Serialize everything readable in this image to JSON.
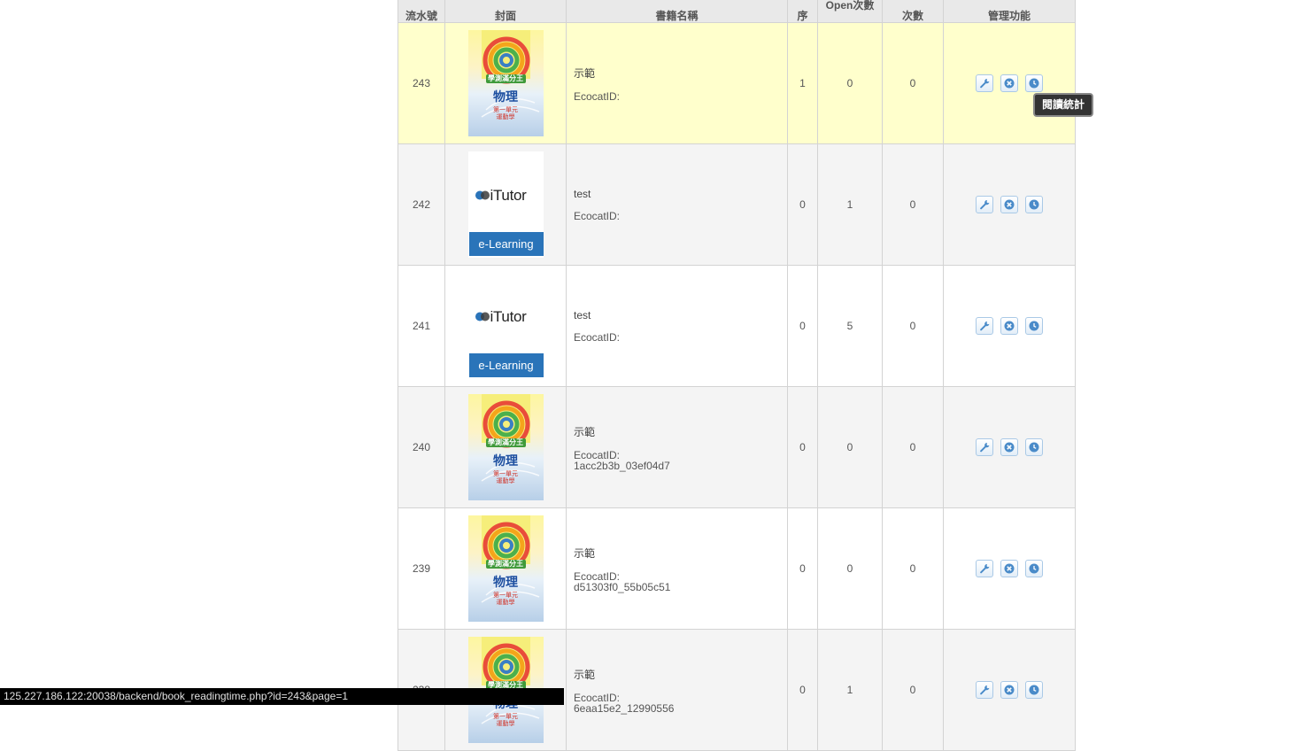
{
  "table": {
    "headers": {
      "serial": "流水號",
      "cover": "封面",
      "book_name": "書籍名稱",
      "order": "序",
      "open_count": "Open次數",
      "download_count": "次數",
      "manage": "管理功能"
    },
    "rows": [
      {
        "id": "243",
        "title": "示範",
        "ecocat_label": "EcocatID:",
        "ecocat_id": "",
        "order": "1",
        "open": "0",
        "download": "0",
        "cover": "physics",
        "highlight": true
      },
      {
        "id": "242",
        "title": "test",
        "ecocat_label": "EcocatID:",
        "ecocat_id": "",
        "order": "0",
        "open": "1",
        "download": "0",
        "cover": "itutor"
      },
      {
        "id": "241",
        "title": "test",
        "ecocat_label": "EcocatID:",
        "ecocat_id": "",
        "order": "0",
        "open": "5",
        "download": "0",
        "cover": "itutor"
      },
      {
        "id": "240",
        "title": "示範",
        "ecocat_label": "EcocatID:",
        "ecocat_id": "1acc2b3b_03ef04d7",
        "order": "0",
        "open": "0",
        "download": "0",
        "cover": "physics"
      },
      {
        "id": "239",
        "title": "示範",
        "ecocat_label": "EcocatID:",
        "ecocat_id": "d51303f0_55b05c51",
        "order": "0",
        "open": "0",
        "download": "0",
        "cover": "physics"
      },
      {
        "id": "238",
        "title": "示範",
        "ecocat_label": "EcocatID:",
        "ecocat_id": "6eaa15e2_12990556",
        "order": "0",
        "open": "1",
        "download": "0",
        "cover": "physics"
      }
    ],
    "actions": {
      "edit_icon": "wrench-icon",
      "delete_icon": "close-circle-icon",
      "stats_icon": "clock-icon"
    }
  },
  "covers": {
    "physics": {
      "series": "學測滿分王",
      "subject": "物理",
      "unit": "第一單元",
      "topic": "運動學"
    },
    "itutor": {
      "logo": "iTutor",
      "band": "e-Learning"
    }
  },
  "tooltip": {
    "text": "閱讀統計"
  },
  "status_bar": {
    "url": "125.227.186.122:20038/backend/book_readingtime.php?id=243&page=1"
  },
  "colors": {
    "highlight_row": "#ffffcc",
    "alt_row": "#f4f4f4",
    "header": "#e9e9e9",
    "button_icon": "#4a8bc9",
    "itutor_band": "#2a74b9"
  }
}
